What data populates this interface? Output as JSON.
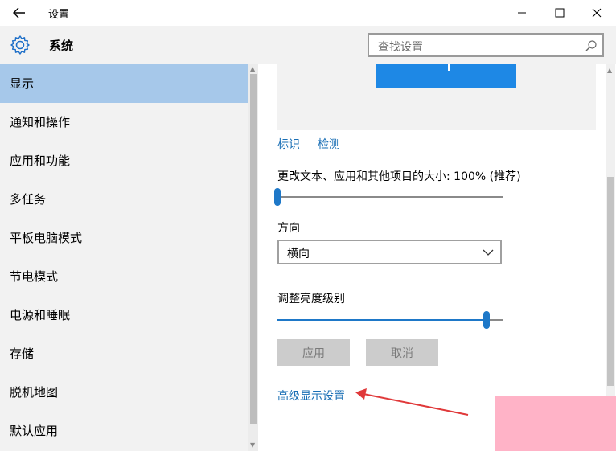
{
  "window": {
    "title": "设置"
  },
  "header": {
    "section_title": "系统",
    "search_placeholder": "查找设置"
  },
  "sidebar": {
    "items": [
      {
        "label": "显示",
        "active": true
      },
      {
        "label": "通知和操作"
      },
      {
        "label": "应用和功能"
      },
      {
        "label": "多任务"
      },
      {
        "label": "平板电脑模式"
      },
      {
        "label": "节电模式"
      },
      {
        "label": "电源和睡眠"
      },
      {
        "label": "存储"
      },
      {
        "label": "脱机地图"
      },
      {
        "label": "默认应用"
      }
    ]
  },
  "display": {
    "identify_link": "标识",
    "detect_link": "检测",
    "scale_label": "更改文本、应用和其他项目的大小: 100% (推荐)",
    "scale_level": 0,
    "orientation_label": "方向",
    "orientation_value": "横向",
    "brightness_label": "调整亮度级别",
    "brightness_level": 0.93,
    "apply_button": "应用",
    "cancel_button": "取消",
    "advanced_link": "高级显示设置"
  },
  "colors": {
    "accent": "#1e88e5",
    "active_nav": "#a6c8ea",
    "link": "#1a6fb5",
    "annotation_arrow": "#e0393a",
    "highlight_box": "#ffb3c7"
  }
}
